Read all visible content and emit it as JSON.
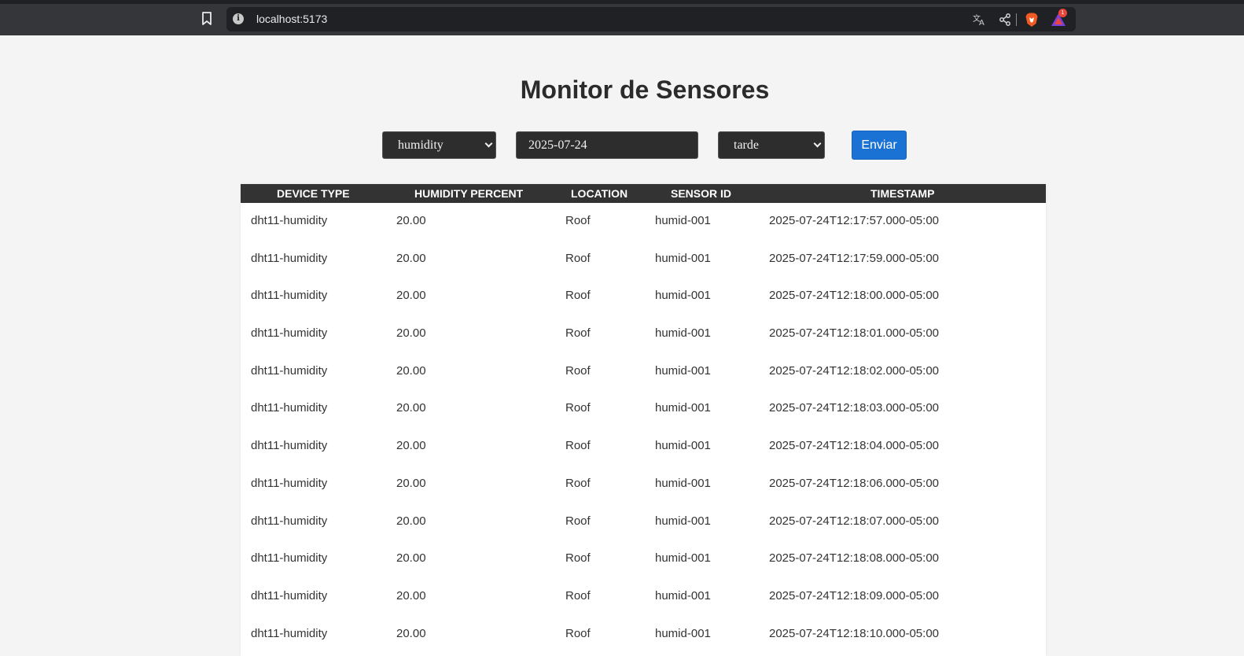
{
  "browser": {
    "url": "localhost:5173",
    "badge_count": "1"
  },
  "page": {
    "title": "Monitor de Sensores"
  },
  "filters": {
    "sensor_type": "humidity",
    "date": "2025-07-24",
    "period": "tarde",
    "submit_label": "Enviar"
  },
  "table": {
    "columns": [
      "DEVICE TYPE",
      "HUMIDITY PERCENT",
      "LOCATION",
      "SENSOR ID",
      "TIMESTAMP"
    ],
    "rows": [
      [
        "dht11-humidity",
        "20.00",
        "Roof",
        "humid-001",
        "2025-07-24T12:17:57.000-05:00"
      ],
      [
        "dht11-humidity",
        "20.00",
        "Roof",
        "humid-001",
        "2025-07-24T12:17:59.000-05:00"
      ],
      [
        "dht11-humidity",
        "20.00",
        "Roof",
        "humid-001",
        "2025-07-24T12:18:00.000-05:00"
      ],
      [
        "dht11-humidity",
        "20.00",
        "Roof",
        "humid-001",
        "2025-07-24T12:18:01.000-05:00"
      ],
      [
        "dht11-humidity",
        "20.00",
        "Roof",
        "humid-001",
        "2025-07-24T12:18:02.000-05:00"
      ],
      [
        "dht11-humidity",
        "20.00",
        "Roof",
        "humid-001",
        "2025-07-24T12:18:03.000-05:00"
      ],
      [
        "dht11-humidity",
        "20.00",
        "Roof",
        "humid-001",
        "2025-07-24T12:18:04.000-05:00"
      ],
      [
        "dht11-humidity",
        "20.00",
        "Roof",
        "humid-001",
        "2025-07-24T12:18:06.000-05:00"
      ],
      [
        "dht11-humidity",
        "20.00",
        "Roof",
        "humid-001",
        "2025-07-24T12:18:07.000-05:00"
      ],
      [
        "dht11-humidity",
        "20.00",
        "Roof",
        "humid-001",
        "2025-07-24T12:18:08.000-05:00"
      ],
      [
        "dht11-humidity",
        "20.00",
        "Roof",
        "humid-001",
        "2025-07-24T12:18:09.000-05:00"
      ],
      [
        "dht11-humidity",
        "20.00",
        "Roof",
        "humid-001",
        "2025-07-24T12:18:10.000-05:00"
      ]
    ]
  }
}
